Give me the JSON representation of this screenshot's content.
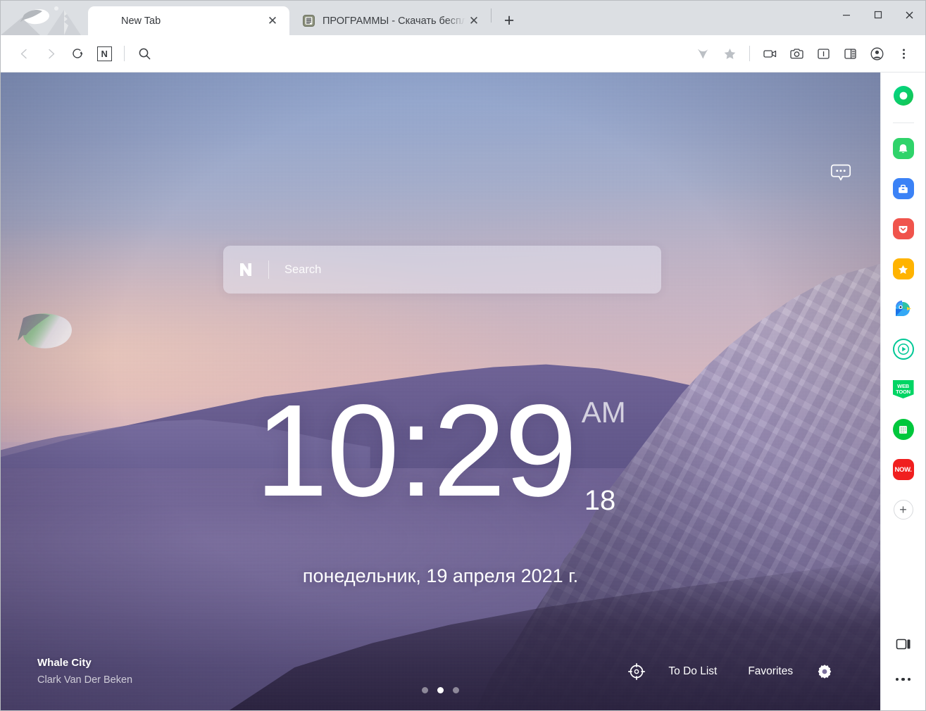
{
  "window": {
    "controls": {
      "minimize": "minimize",
      "maximize": "maximize",
      "close": "close"
    }
  },
  "tabbar": {
    "tabs": [
      {
        "title": "New Tab",
        "active": true,
        "favicon": "none"
      },
      {
        "title": "ПРОГРАММЫ - Скачать беспл",
        "active": false,
        "favicon": "site-favicon"
      }
    ],
    "new_tab_label": "+",
    "close_label": "✕"
  },
  "toolbar": {
    "back": "back",
    "forward": "forward",
    "reload": "reload",
    "home_letter": "N",
    "search": "search",
    "right_icons": [
      "whale-icon",
      "star-icon",
      "video-capture-icon",
      "screenshot-icon",
      "sidebar-toggle-icon",
      "split-screen-icon",
      "account-icon",
      "menu-icon"
    ]
  },
  "newtab": {
    "chat_bubble": "quick-chat",
    "search": {
      "logo": "N",
      "placeholder": "Search",
      "value": ""
    },
    "clock": {
      "time": "10:29",
      "ampm": "AM",
      "seconds": "18",
      "date": "понедельник, 19 апреля 2021 г."
    },
    "carousel": {
      "count": 3,
      "active_index": 1
    },
    "credit": {
      "title": "Whale City",
      "author": "Clark Van Der Beken"
    },
    "bottom_actions": [
      {
        "type": "icon",
        "name": "target-icon",
        "label": ""
      },
      {
        "type": "label",
        "name": "todo-list",
        "label": "To Do List"
      },
      {
        "type": "label",
        "name": "favorites",
        "label": "Favorites"
      },
      {
        "type": "icon",
        "name": "settings-gear-icon",
        "label": ""
      }
    ]
  },
  "sidebar": {
    "items": [
      {
        "name": "whale-space-icon",
        "color": "#1ec800"
      },
      {
        "name": "notification-bell-icon",
        "color": "#2fd36a"
      },
      {
        "name": "toolbox-icon",
        "color": "#3b82f6"
      },
      {
        "name": "heart-pocket-icon",
        "color": "#f0544c"
      },
      {
        "name": "star-bookmark-icon",
        "color": "#ffb300"
      },
      {
        "name": "papago-parrot-icon",
        "color": "#4285f4"
      },
      {
        "name": "video-play-icon",
        "color": "#00c896"
      },
      {
        "name": "webtoon-icon",
        "color": "#00d564",
        "label_line1": "WEB",
        "label_line2": "TOON"
      },
      {
        "name": "green-grid-icon",
        "color": "#00c73c"
      },
      {
        "name": "now-icon",
        "color": "#f01f1f",
        "label": "NOW."
      }
    ],
    "add_button": "+",
    "bottom": [
      {
        "name": "panel-toggle-icon"
      },
      {
        "name": "more-options-icon"
      }
    ]
  },
  "colors": {
    "tabbar_bg": "#dcdfe3",
    "toolbar_bg": "#ffffff",
    "sidebar_bg": "#ffffff",
    "accent_green": "#00c73c",
    "accent_red": "#f01f1f",
    "wallpaper_sky_top": "#8fa5cf",
    "wallpaper_sea": "#6c5f92"
  }
}
